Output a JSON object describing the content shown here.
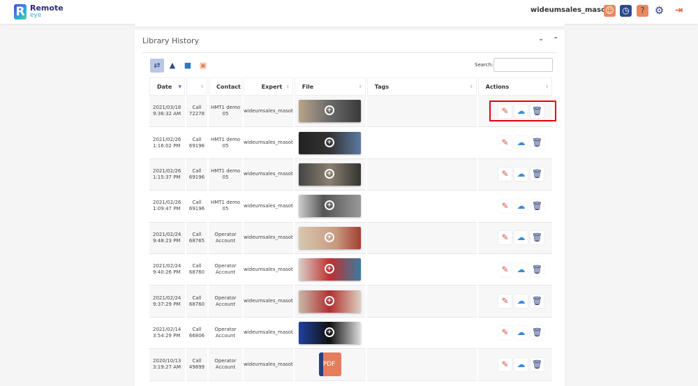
{
  "header": {
    "brand": "Remote",
    "brand_sub": "eye",
    "username": "wideumsales_masot",
    "icons": [
      "contacts-icon",
      "call-history-icon",
      "help-file-icon",
      "settings-icon",
      "logout-icon"
    ]
  },
  "library": {
    "title": "Library History",
    "filters": [
      "all-media-icon",
      "image-icon",
      "video-icon",
      "pdf-icon"
    ],
    "search_label": "Search:",
    "search_value": ""
  },
  "table": {
    "headers": [
      "Date",
      "",
      "Contact",
      "Expert",
      "File",
      "Tags",
      "Actions"
    ],
    "rows": [
      {
        "date": "2021/03/18",
        "time": "9:36:32 AM",
        "call": "Call",
        "call_id": "72278",
        "contact": "HMT1 demo",
        "contact2": "05",
        "expert": "wideumsales_masot",
        "file": "image"
      },
      {
        "date": "2021/02/26",
        "time": "1:16:02 PM",
        "call": "Call",
        "call_id": "69196",
        "contact": "HMT1 demo",
        "contact2": "05",
        "expert": "wideumsales_masot",
        "file": "image"
      },
      {
        "date": "2021/02/26",
        "time": "1:15:37 PM",
        "call": "Call",
        "call_id": "69196",
        "contact": "HMT1 demo",
        "contact2": "05",
        "expert": "wideumsales_masot",
        "file": "image"
      },
      {
        "date": "2021/02/26",
        "time": "1:09:47 PM",
        "call": "Call",
        "call_id": "69196",
        "contact": "HMT1 demo",
        "contact2": "05",
        "expert": "wideumsales_masot",
        "file": "image"
      },
      {
        "date": "2021/02/24",
        "time": "9:48:23 PM",
        "call": "Call",
        "call_id": "68765",
        "contact": "Operator",
        "contact2": "Account",
        "expert": "wideumsales_masot",
        "file": "image"
      },
      {
        "date": "2021/02/24",
        "time": "9:40:26 PM",
        "call": "Call",
        "call_id": "68760",
        "contact": "Operator",
        "contact2": "Account",
        "expert": "wideumsales_masot",
        "file": "image"
      },
      {
        "date": "2021/02/24",
        "time": "9:37:29 PM",
        "call": "Call",
        "call_id": "68760",
        "contact": "Operator",
        "contact2": "Account",
        "expert": "wideumsales_masot",
        "file": "image"
      },
      {
        "date": "2021/02/14",
        "time": "3:54:29 PM",
        "call": "Call",
        "call_id": "66806",
        "contact": "Operator",
        "contact2": "Account",
        "expert": "wideumsales_masot",
        "file": "image"
      },
      {
        "date": "2020/10/13",
        "time": "3:19:27 AM",
        "call": "Call",
        "call_id": "49899",
        "contact": "Operator",
        "contact2": "Account",
        "expert": "wideumsales_masot",
        "file": "pdf",
        "pdf_label": "PDF"
      }
    ]
  },
  "colors": {
    "highlight": "#e8000b",
    "accent": "#2c3e7a"
  }
}
